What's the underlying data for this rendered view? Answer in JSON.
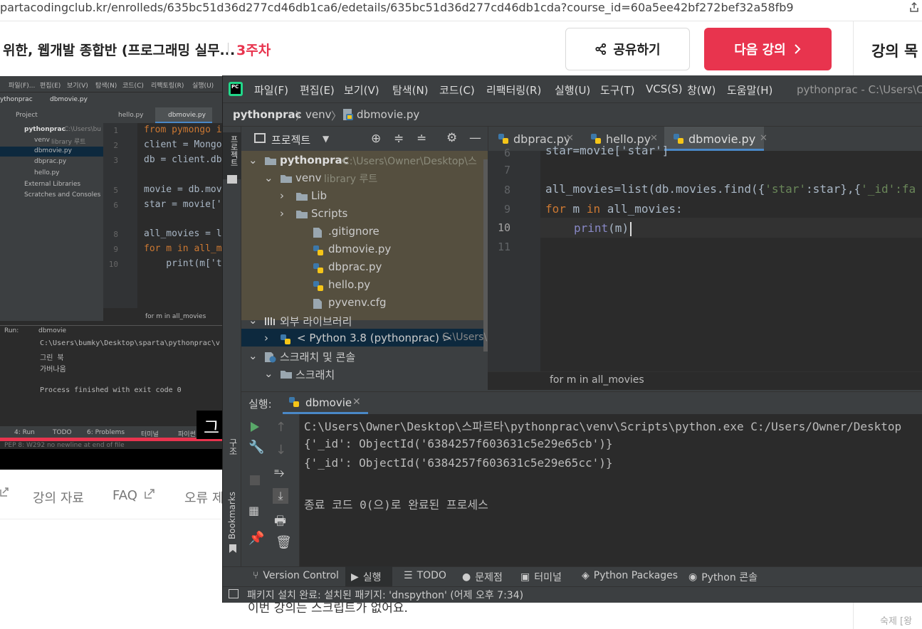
{
  "browser": {
    "url": "partacodingclub.kr/enrolleds/635bc51d36d277cd46db1ca6/edetails/635bc51d36d277cd46db1cda?course_id=60a5ee42bf272bef32a58fb9"
  },
  "header": {
    "course_title": "위한, 웹개발 종합반 (프로그래밍 실무...",
    "week": "3주차",
    "share_label": "공유하기",
    "next_label": "다음 강의",
    "lesson_list_label": "강의 목"
  },
  "bottom_nav": {
    "materials": "강의 자료",
    "faq": "FAQ",
    "error": "오류 제"
  },
  "sidebar_footer": {
    "homework": "숙제 [왕"
  },
  "page_text": "이번 강의는 스크립트가 없어요.",
  "video_ide": {
    "menu": [
      "파일(F)...",
      "편집(E)",
      "보기(V)",
      "탐색(N)",
      "코드(C)",
      "리팩토링(R)",
      "실행(U)"
    ],
    "breadcrumb_project": "ythonprac",
    "breadcrumb_file": "dbmovie.py",
    "project_tab": "Project",
    "tabs": [
      "hello.py",
      "dbmovie.py"
    ],
    "tree": [
      {
        "label": "pythonprac",
        "note": "C:\\Users\\bu"
      },
      {
        "label": "venv",
        "note": "library 루트"
      },
      {
        "label": "dbmovie.py",
        "note": ""
      },
      {
        "label": "dbprac.py",
        "note": ""
      },
      {
        "label": "hello.py",
        "note": ""
      },
      {
        "label": "External Libraries",
        "note": ""
      },
      {
        "label": "Scratches and Consoles",
        "note": ""
      }
    ],
    "line_numbers": [
      "1",
      "2",
      "3",
      "",
      "5",
      "6",
      "",
      "8",
      "9",
      "10"
    ],
    "code": [
      "from pymongo i",
      "client = Mongo",
      "db = client.db",
      "",
      "movie = db.mov",
      "star = movie['",
      "",
      "all_movies = l",
      "for m in all_m",
      "    print(m['t"
    ],
    "status": "for m in all_movies",
    "run_label": "Run:",
    "run_tab": "dbmovie",
    "run_output": [
      "C:\\Users\\bumky\\Desktop\\sparta\\pythonprac\\v",
      "그린 북",
      "가버나움",
      "",
      "Process finished with exit code 0"
    ],
    "bottom_tabs": [
      "4: Run",
      "TODO",
      "6: Problems",
      "터미널",
      "파이썬"
    ],
    "pep": "PEP 8: W292 no newline at end of file",
    "subtitle": "그"
  },
  "ide": {
    "menu": [
      "파일(F)",
      "편집(E)",
      "보기(V)",
      "탐색(N)",
      "코드(C)",
      "리팩터링(R)",
      "실행(U)",
      "도구(T)",
      "VCS(S)",
      "창(W)",
      "도움말(H)"
    ],
    "window_title": "pythonprac - C:\\Users\\O",
    "breadcrumb": [
      "pythonprac",
      "venv",
      "dbmovie.py"
    ],
    "project_label": "프로젝트",
    "side_strip": "프로젝트",
    "tree": [
      {
        "label": "pythonprac",
        "note": "C:\\Users\\Owner\\Desktop\\스"
      },
      {
        "label": "venv",
        "note": "library 루트"
      },
      {
        "label": "Lib",
        "note": ""
      },
      {
        "label": "Scripts",
        "note": ""
      },
      {
        "label": ".gitignore",
        "note": ""
      },
      {
        "label": "dbmovie.py",
        "note": ""
      },
      {
        "label": "dbprac.py",
        "note": ""
      },
      {
        "label": "hello.py",
        "note": ""
      },
      {
        "label": "pyvenv.cfg",
        "note": ""
      },
      {
        "label": "외부 라이브러리",
        "note": ""
      },
      {
        "label": "< Python 3.8 (pythonprac) >",
        "note": "C:\\Users\\"
      },
      {
        "label": "스크래치 및 콘솔",
        "note": ""
      },
      {
        "label": "스크래치",
        "note": ""
      }
    ],
    "tabs": [
      "dbprac.py",
      "hello.py",
      "dbmovie.py"
    ],
    "line_numbers": [
      "6",
      "7",
      "8",
      "9",
      "10",
      "11"
    ],
    "code": {
      "l6": "star=movie['star']",
      "l8_a": "all_movies=list(db.movies.find({",
      "l8_b": "'star'",
      "l8_c": ":star},{",
      "l8_d": "'_id':fa",
      "l9_a": "for",
      "l9_b": " m ",
      "l9_c": "in",
      "l9_d": " all_movies:",
      "l10_a": "print",
      "l10_b": "(m)"
    },
    "status": "for m in all_movies",
    "run_label": "실행:",
    "run_tab": "dbmovie",
    "side_strip_structure": "구조",
    "side_strip_bookmarks": "Bookmarks",
    "output": [
      "C:\\Users\\Owner\\Desktop\\스파르타\\pythonprac\\venv\\Scripts\\python.exe C:/Users/Owner/Desktop",
      "{'_id': ObjectId('6384257f603631c5e29e65cb')}",
      "{'_id': ObjectId('6384257f603631c5e29e65cc')}",
      "",
      "종료 코드 0(으)로 완료된 프로세스"
    ],
    "bottom_tabs": [
      "Version Control",
      "실행",
      "TODO",
      "문제점",
      "터미널",
      "Python Packages",
      "Python 콘솔"
    ],
    "statusbar": "패키지 설치 완료: 설치된 패키지: 'dnspython' (어제 오후 7:34)"
  },
  "colors": {
    "accent": "#e8344e",
    "ide_bg": "#2b2b2b",
    "ide_panel": "#3c3f41",
    "keyword": "#cc7832",
    "string": "#6a8759"
  }
}
